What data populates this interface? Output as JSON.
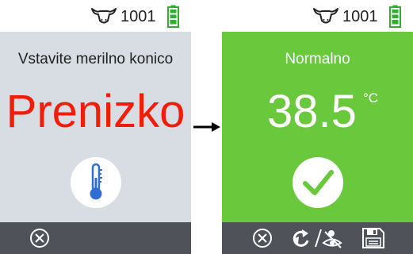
{
  "status_bar": {
    "animal_id": "1001",
    "cow_icon": "cow-head-icon",
    "battery_icon": "battery-full-icon",
    "battery_level": 1.0,
    "battery_color": "#2fae2f"
  },
  "left_screen": {
    "instruction": "Vstavite merilno konico",
    "status": "Prenizko",
    "status_color": "#f21c0a",
    "background_color": "#d8dde3",
    "icon": "thermometer-icon",
    "buttons": [
      {
        "icon": "close-icon"
      }
    ]
  },
  "right_screen": {
    "status": "Normalno",
    "temperature": "38.5",
    "unit": "°C",
    "background_color": "#69c83c",
    "icon": "checkmark-icon",
    "buttons": [
      {
        "icon": "close-icon"
      },
      {
        "icon": "repeat-hide-icon"
      },
      {
        "icon": "save-icon"
      }
    ]
  },
  "colors": {
    "bottom_bar": "#4f5259",
    "thermometer_blue": "#2f6fd3"
  }
}
